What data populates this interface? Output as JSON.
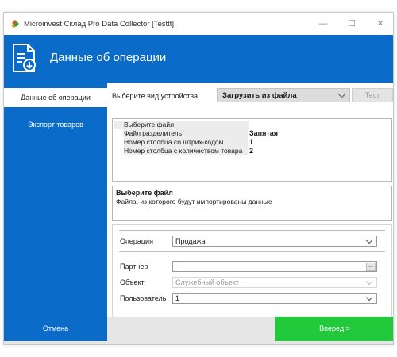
{
  "window": {
    "title": "Microinvest Склад Pro Data Collector [Testtt]",
    "controls": {
      "minimize": "—",
      "maximize": "☐",
      "close": "✕"
    }
  },
  "header": {
    "title": "Данные об операции",
    "icon": "document-import-icon"
  },
  "sidebar": {
    "items": [
      {
        "label": "Данные об операции",
        "active": true
      },
      {
        "label": "Экспорт товаров",
        "active": false
      }
    ]
  },
  "device": {
    "label": "Выберите вид устройства",
    "selected": "Загрузить из файла",
    "test_label": "Тест"
  },
  "properties": [
    {
      "key": "Выберите файл",
      "value": ""
    },
    {
      "key": "Файл разделитель",
      "value": "Запятая"
    },
    {
      "key": "Номер столбца со штрих-кодом",
      "value": "1"
    },
    {
      "key": "Номер столбца с количеством товара",
      "value": "2"
    }
  ],
  "description": {
    "title": "Выберите файл",
    "text": "Файла, из которого будут импортированы данные"
  },
  "form": {
    "operation": {
      "label": "Операция",
      "value": "Продажа"
    },
    "partner": {
      "label": "Партнер",
      "value": "",
      "browse": "..."
    },
    "object": {
      "label": "Объект",
      "value": "Служебный объект"
    },
    "user": {
      "label": "Пользователь",
      "value": "1"
    }
  },
  "footer": {
    "cancel_label": "Отмена",
    "next_label": "Вперед >"
  },
  "colors": {
    "accent": "#0a6cc8",
    "next": "#22c93a",
    "footer_bg": "#e6e6e6"
  }
}
